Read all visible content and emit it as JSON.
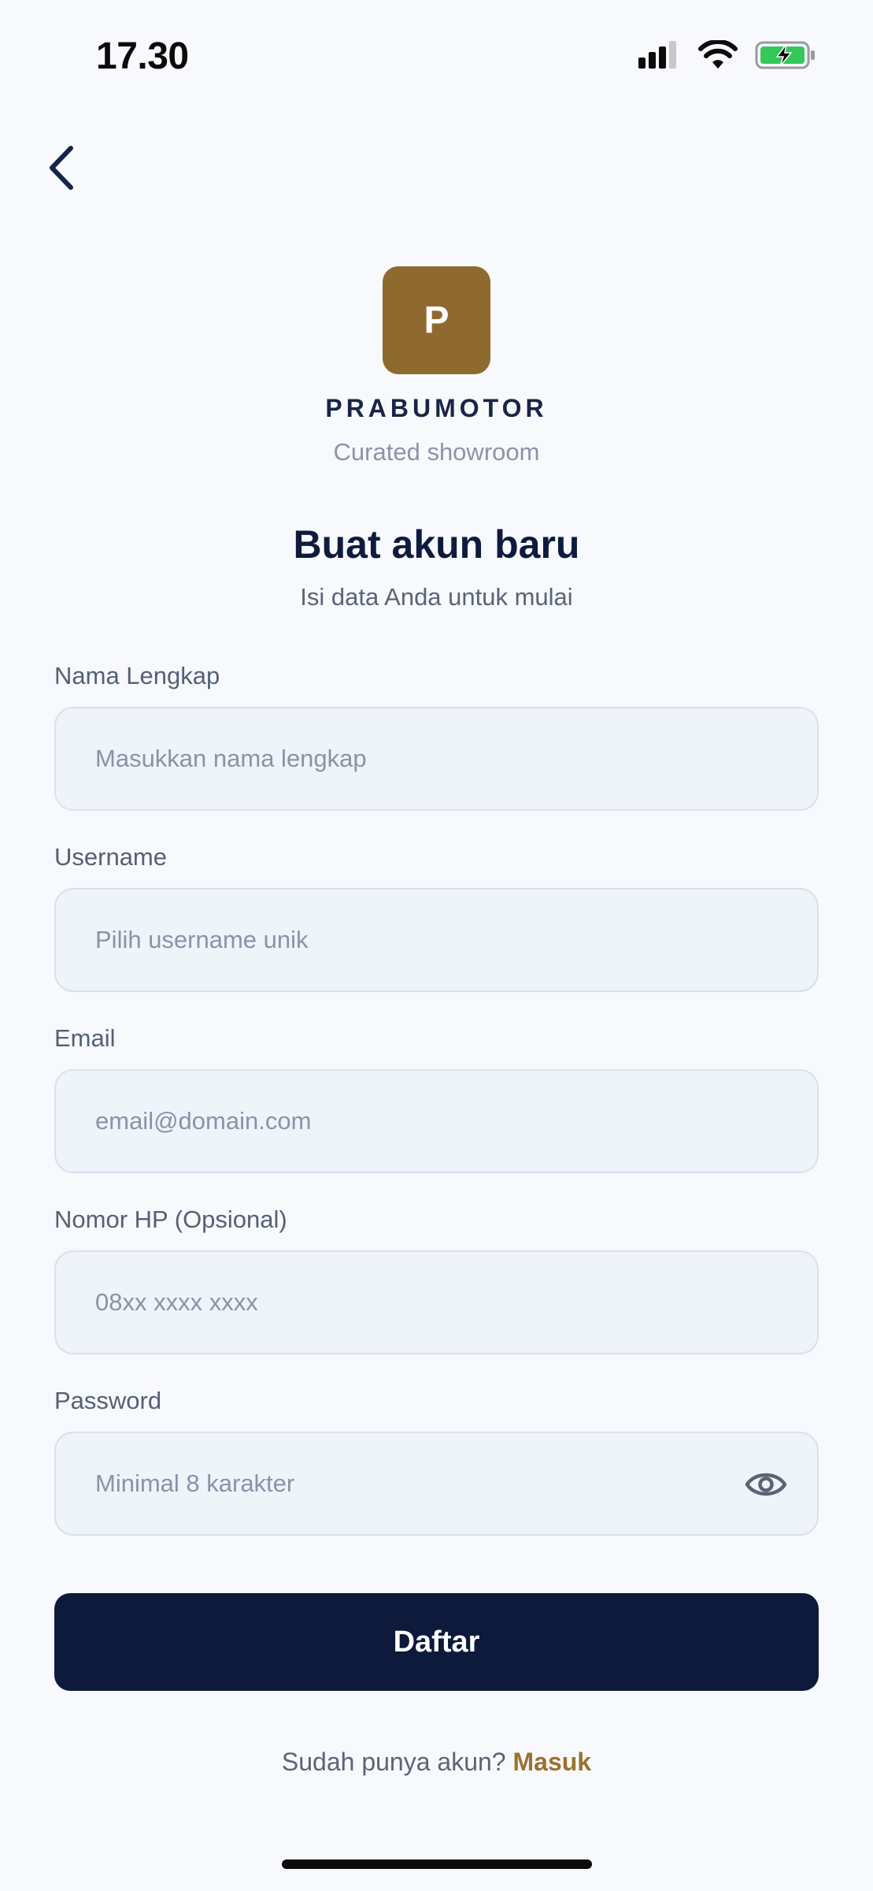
{
  "status_bar": {
    "time": "17.30"
  },
  "brand": {
    "logo_letter": "P",
    "name": "PRABUMOTOR",
    "tagline": "Curated showroom",
    "accent_color": "#8f6a2e"
  },
  "page": {
    "title": "Buat akun baru",
    "subtitle": "Isi data Anda untuk mulai"
  },
  "form": {
    "fields": [
      {
        "label": "Nama Lengkap",
        "placeholder": "Masukkan nama lengkap"
      },
      {
        "label": "Username",
        "placeholder": "Pilih username unik"
      },
      {
        "label": "Email",
        "placeholder": "email@domain.com"
      },
      {
        "label": "Nomor HP (Opsional)",
        "placeholder": "08xx xxxx xxxx"
      },
      {
        "label": "Password",
        "placeholder": "Minimal 8 karakter",
        "icon": "eye-icon"
      }
    ],
    "submit_label": "Daftar"
  },
  "footer": {
    "prompt": "Sudah punya akun?",
    "link": "Masuk"
  },
  "colors": {
    "primary": "#0e1a3b",
    "background": "#f7f9fc",
    "link": "#9a7230"
  }
}
